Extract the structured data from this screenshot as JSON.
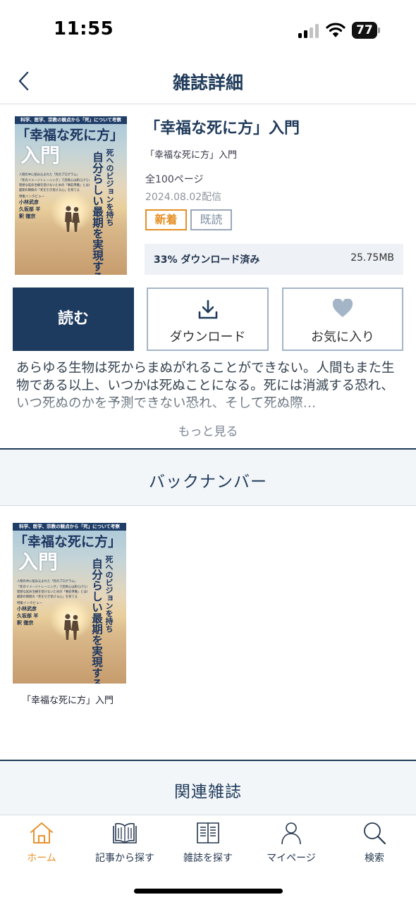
{
  "status_bar": {
    "time": "11:55",
    "battery": "77",
    "icons": [
      "signal-icon",
      "wifi-icon",
      "battery-icon"
    ]
  },
  "header": {
    "title": "雑誌詳細",
    "back_icon": "chevron-left-icon"
  },
  "magazine": {
    "title": "「幸福な死に方」入門",
    "name": "「幸福な死に方」入門",
    "pages": "全100ページ",
    "date": "2024.08.02配信",
    "badges": {
      "new": "新着",
      "read": "既読"
    },
    "download": {
      "status": "33% ダウンロード済み",
      "size": "25.75MB",
      "progress": 0.33
    },
    "cover": {
      "top_strip": "科学、医学、宗教の観点から「死」について考察",
      "title": "「幸福な死に方」",
      "title2": "入門",
      "sub1": "死へのビジョンを持ち",
      "sub2": "自分らしい最期を実現する",
      "line1": "人間の中に組み込まれた「死のプログラム」",
      "line2": "「死のイメージトレーニング」で恐怖心は和らげられる",
      "line3": "理想な延命治療を受けないための「事前準備」とは何か",
      "line4": "最期の瞬間の「死を引き受ける心」を育てる",
      "interview": "特集インタビュー",
      "person1": "小林武彦",
      "person2": "久坂部 羊",
      "person3": "釈 徹宗"
    }
  },
  "actions": {
    "read": "読む",
    "download": "ダウンロード",
    "favorite": "お気に入り"
  },
  "description": "あらゆる生物は死からまぬがれることができない。人間もまた生物である以上、いつかは死ぬことになる。死には消滅する恐れ、いつ死ぬのかを予測できない恐れ、そして死ぬ際…",
  "more_label": "もっと見る",
  "sections": {
    "back_numbers": "バックナンバー",
    "related": "関連雑誌"
  },
  "back_numbers": [
    {
      "caption": "「幸福な死に方」入門"
    }
  ],
  "tabs": [
    {
      "label": "ホーム",
      "icon": "home-icon",
      "active": true
    },
    {
      "label": "記事から探す",
      "icon": "book-open-icon",
      "active": false
    },
    {
      "label": "雑誌を探す",
      "icon": "magazine-icon",
      "active": false
    },
    {
      "label": "マイページ",
      "icon": "person-icon",
      "active": false
    },
    {
      "label": "検索",
      "icon": "search-icon",
      "active": false
    }
  ],
  "colors": {
    "navy": "#1d3a5f",
    "accent_orange": "#e8932c",
    "outline": "#a5b5c8",
    "read_badge": "#7f8fa3"
  }
}
